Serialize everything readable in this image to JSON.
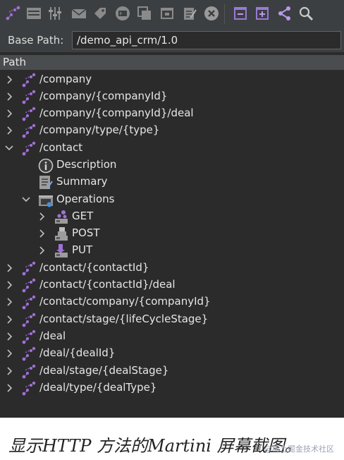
{
  "toolbar": {
    "icons": [
      "path-icon",
      "grid-icon",
      "sliders-icon",
      "mail-icon",
      "tag-icon",
      "terminal-icon",
      "copy-icon",
      "window-icon",
      "edit-icon",
      "close-circle-icon",
      "collapse-all-icon",
      "expand-all-icon",
      "share-icon",
      "search-icon"
    ]
  },
  "base_path": {
    "label": "Base Path:",
    "value": "/demo_api_crm/1.0"
  },
  "tree": {
    "header": "Path",
    "nodes": [
      {
        "label": "/company"
      },
      {
        "label": "/company/{companyId}"
      },
      {
        "label": "/company/{companyId}/deal"
      },
      {
        "label": "/company/type/{type}"
      },
      {
        "label": "/contact",
        "expanded": true
      },
      {
        "label": "Description"
      },
      {
        "label": "Summary"
      },
      {
        "label": "Operations",
        "expanded": true
      },
      {
        "label": "GET"
      },
      {
        "label": "POST"
      },
      {
        "label": "PUT"
      },
      {
        "label": "/contact/{contactId}"
      },
      {
        "label": "/contact/{contactId}/deal"
      },
      {
        "label": "/contact/company/{companyId}"
      },
      {
        "label": "/contact/stage/{lifeCycleStage}"
      },
      {
        "label": "/deal"
      },
      {
        "label": "/deal/{dealId}"
      },
      {
        "label": "/deal/stage/{dealStage}"
      },
      {
        "label": "/deal/type/{dealType}"
      }
    ]
  },
  "caption": "显示HTTP 方法的Martini 屏幕截图。",
  "watermark": "@稀土掘金技术社区",
  "colors": {
    "panel_bg": "#2b2b2b",
    "toolbar_bg": "#3c3f41",
    "path_icon": "#a071d8",
    "info_icon": "#c9c9c9"
  }
}
